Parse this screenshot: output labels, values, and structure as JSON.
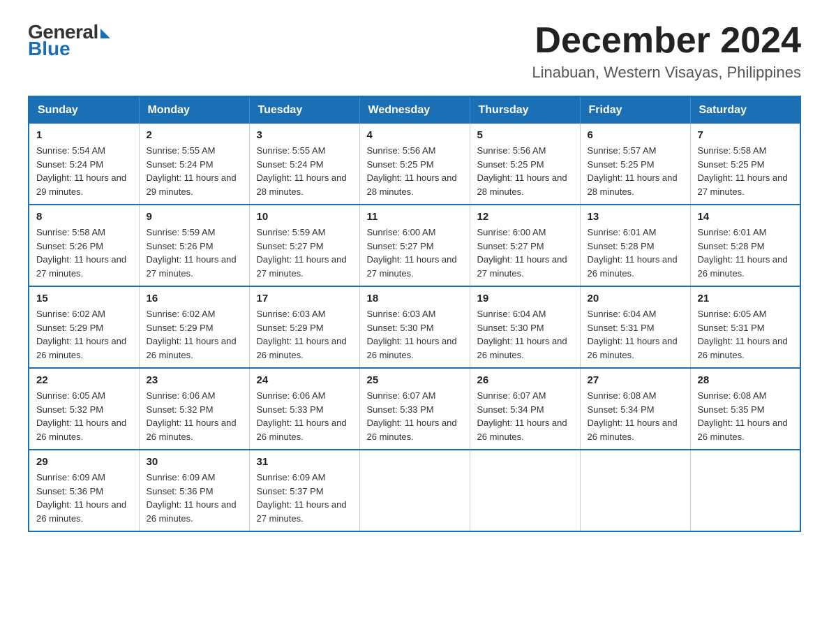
{
  "logo": {
    "general": "General",
    "blue": "Blue"
  },
  "header": {
    "title": "December 2024",
    "location": "Linabuan, Western Visayas, Philippines"
  },
  "weekdays": [
    "Sunday",
    "Monday",
    "Tuesday",
    "Wednesday",
    "Thursday",
    "Friday",
    "Saturday"
  ],
  "weeks": [
    [
      {
        "day": "1",
        "sunrise": "5:54 AM",
        "sunset": "5:24 PM",
        "daylight": "11 hours and 29 minutes"
      },
      {
        "day": "2",
        "sunrise": "5:55 AM",
        "sunset": "5:24 PM",
        "daylight": "11 hours and 29 minutes"
      },
      {
        "day": "3",
        "sunrise": "5:55 AM",
        "sunset": "5:24 PM",
        "daylight": "11 hours and 28 minutes"
      },
      {
        "day": "4",
        "sunrise": "5:56 AM",
        "sunset": "5:25 PM",
        "daylight": "11 hours and 28 minutes"
      },
      {
        "day": "5",
        "sunrise": "5:56 AM",
        "sunset": "5:25 PM",
        "daylight": "11 hours and 28 minutes"
      },
      {
        "day": "6",
        "sunrise": "5:57 AM",
        "sunset": "5:25 PM",
        "daylight": "11 hours and 28 minutes"
      },
      {
        "day": "7",
        "sunrise": "5:58 AM",
        "sunset": "5:25 PM",
        "daylight": "11 hours and 27 minutes"
      }
    ],
    [
      {
        "day": "8",
        "sunrise": "5:58 AM",
        "sunset": "5:26 PM",
        "daylight": "11 hours and 27 minutes"
      },
      {
        "day": "9",
        "sunrise": "5:59 AM",
        "sunset": "5:26 PM",
        "daylight": "11 hours and 27 minutes"
      },
      {
        "day": "10",
        "sunrise": "5:59 AM",
        "sunset": "5:27 PM",
        "daylight": "11 hours and 27 minutes"
      },
      {
        "day": "11",
        "sunrise": "6:00 AM",
        "sunset": "5:27 PM",
        "daylight": "11 hours and 27 minutes"
      },
      {
        "day": "12",
        "sunrise": "6:00 AM",
        "sunset": "5:27 PM",
        "daylight": "11 hours and 27 minutes"
      },
      {
        "day": "13",
        "sunrise": "6:01 AM",
        "sunset": "5:28 PM",
        "daylight": "11 hours and 26 minutes"
      },
      {
        "day": "14",
        "sunrise": "6:01 AM",
        "sunset": "5:28 PM",
        "daylight": "11 hours and 26 minutes"
      }
    ],
    [
      {
        "day": "15",
        "sunrise": "6:02 AM",
        "sunset": "5:29 PM",
        "daylight": "11 hours and 26 minutes"
      },
      {
        "day": "16",
        "sunrise": "6:02 AM",
        "sunset": "5:29 PM",
        "daylight": "11 hours and 26 minutes"
      },
      {
        "day": "17",
        "sunrise": "6:03 AM",
        "sunset": "5:29 PM",
        "daylight": "11 hours and 26 minutes"
      },
      {
        "day": "18",
        "sunrise": "6:03 AM",
        "sunset": "5:30 PM",
        "daylight": "11 hours and 26 minutes"
      },
      {
        "day": "19",
        "sunrise": "6:04 AM",
        "sunset": "5:30 PM",
        "daylight": "11 hours and 26 minutes"
      },
      {
        "day": "20",
        "sunrise": "6:04 AM",
        "sunset": "5:31 PM",
        "daylight": "11 hours and 26 minutes"
      },
      {
        "day": "21",
        "sunrise": "6:05 AM",
        "sunset": "5:31 PM",
        "daylight": "11 hours and 26 minutes"
      }
    ],
    [
      {
        "day": "22",
        "sunrise": "6:05 AM",
        "sunset": "5:32 PM",
        "daylight": "11 hours and 26 minutes"
      },
      {
        "day": "23",
        "sunrise": "6:06 AM",
        "sunset": "5:32 PM",
        "daylight": "11 hours and 26 minutes"
      },
      {
        "day": "24",
        "sunrise": "6:06 AM",
        "sunset": "5:33 PM",
        "daylight": "11 hours and 26 minutes"
      },
      {
        "day": "25",
        "sunrise": "6:07 AM",
        "sunset": "5:33 PM",
        "daylight": "11 hours and 26 minutes"
      },
      {
        "day": "26",
        "sunrise": "6:07 AM",
        "sunset": "5:34 PM",
        "daylight": "11 hours and 26 minutes"
      },
      {
        "day": "27",
        "sunrise": "6:08 AM",
        "sunset": "5:34 PM",
        "daylight": "11 hours and 26 minutes"
      },
      {
        "day": "28",
        "sunrise": "6:08 AM",
        "sunset": "5:35 PM",
        "daylight": "11 hours and 26 minutes"
      }
    ],
    [
      {
        "day": "29",
        "sunrise": "6:09 AM",
        "sunset": "5:36 PM",
        "daylight": "11 hours and 26 minutes"
      },
      {
        "day": "30",
        "sunrise": "6:09 AM",
        "sunset": "5:36 PM",
        "daylight": "11 hours and 26 minutes"
      },
      {
        "day": "31",
        "sunrise": "6:09 AM",
        "sunset": "5:37 PM",
        "daylight": "11 hours and 27 minutes"
      },
      null,
      null,
      null,
      null
    ]
  ],
  "labels": {
    "sunrise": "Sunrise:",
    "sunset": "Sunset:",
    "daylight": "Daylight:"
  }
}
